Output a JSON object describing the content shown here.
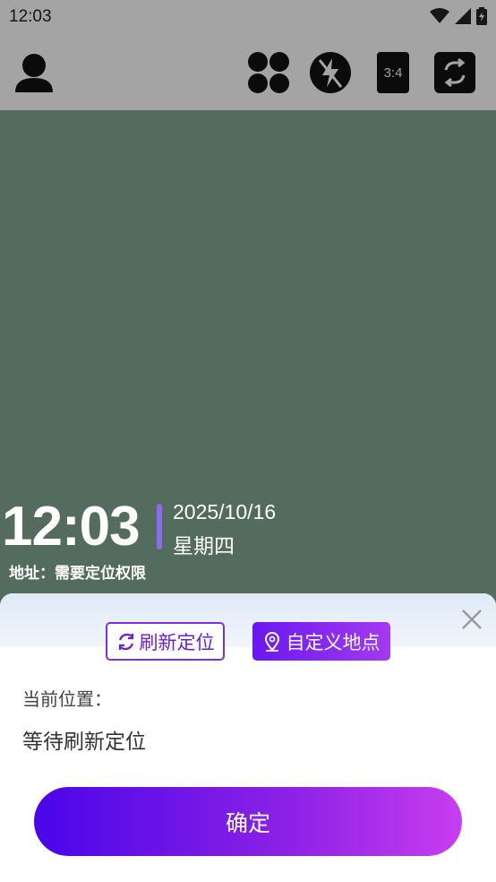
{
  "status_bar": {
    "time": "12:03"
  },
  "toolbar": {
    "aspect_label": "3:4"
  },
  "watermark": {
    "time": "12:03",
    "date": "2025/10/16",
    "weekday": "星期四",
    "address": "地址：需要定位权限"
  },
  "sheet": {
    "refresh_label": "刷新定位",
    "custom_label": "自定义地点",
    "current_location_label": "当前位置：",
    "current_location_value": "等待刷新定位",
    "confirm_label": "确定"
  },
  "colors": {
    "accent": "#6a18f0",
    "watermark_bar": "#8b6cf0"
  }
}
